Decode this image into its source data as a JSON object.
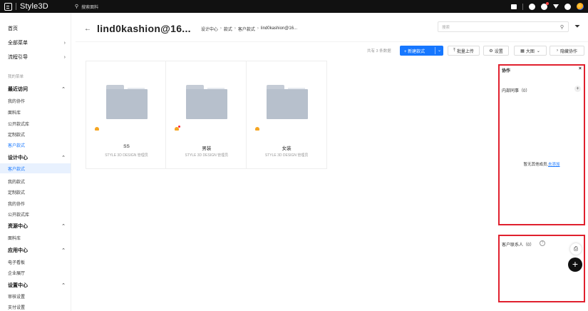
{
  "topbar": {
    "brand": "Style3D",
    "search_placeholder": "搜索面料",
    "icons": [
      "calendar-icon",
      "settings-icon",
      "notification-icon",
      "download-icon",
      "help-icon",
      "avatar"
    ]
  },
  "sidebar": {
    "home": "首页",
    "all_menu": "全部菜单",
    "process_guide": "流程引导",
    "my_menu_caption": "我的菜单",
    "groups": [
      {
        "title": "最近访问",
        "items": [
          "我的协作",
          "面料库",
          "公开款式库",
          "定制款式",
          "客户款式"
        ]
      },
      {
        "title": "设计中心",
        "items": [
          "客户款式",
          "我的款式",
          "定制款式",
          "我的协作",
          "公开款式库"
        ]
      },
      {
        "title": "资源中心",
        "items": [
          "面料库"
        ]
      },
      {
        "title": "应用中心",
        "items": [
          "电子看板",
          "企业展厅"
        ]
      },
      {
        "title": "设置中心",
        "items": [
          "审核设置",
          "支付设置"
        ]
      }
    ]
  },
  "header": {
    "title": "lind0kashion@16...",
    "breadcrumb": [
      "设计中心",
      "款式",
      "客户款式",
      "lind0kashion@16..."
    ],
    "search_placeholder": "搜索"
  },
  "toolbar": {
    "count": "共有 3 条数据",
    "new_style": "+ 新建款式",
    "batch_upload": "批量上传",
    "settings": "设置",
    "view": "大图",
    "hide_collab": "隐藏协作"
  },
  "folders": [
    {
      "name": "SS",
      "owner": "STYLE 3D DESIGN 管理员",
      "badge": false
    },
    {
      "name": "男装",
      "owner": "STYLE 3D DESIGN 管理员",
      "badge": true
    },
    {
      "name": "女装",
      "owner": "STYLE 3D DESIGN 管理员",
      "badge": false
    }
  ],
  "collab_panel": {
    "title": "协作",
    "internal": "内部同事（0）",
    "empty_text": "暂无其他成员,",
    "add_link": "去添加"
  },
  "contact_panel": {
    "title": "客户联系人（0）"
  },
  "colors": {
    "primary": "#1677ff",
    "highlight": "#e0202e",
    "topbar": "#111111"
  }
}
